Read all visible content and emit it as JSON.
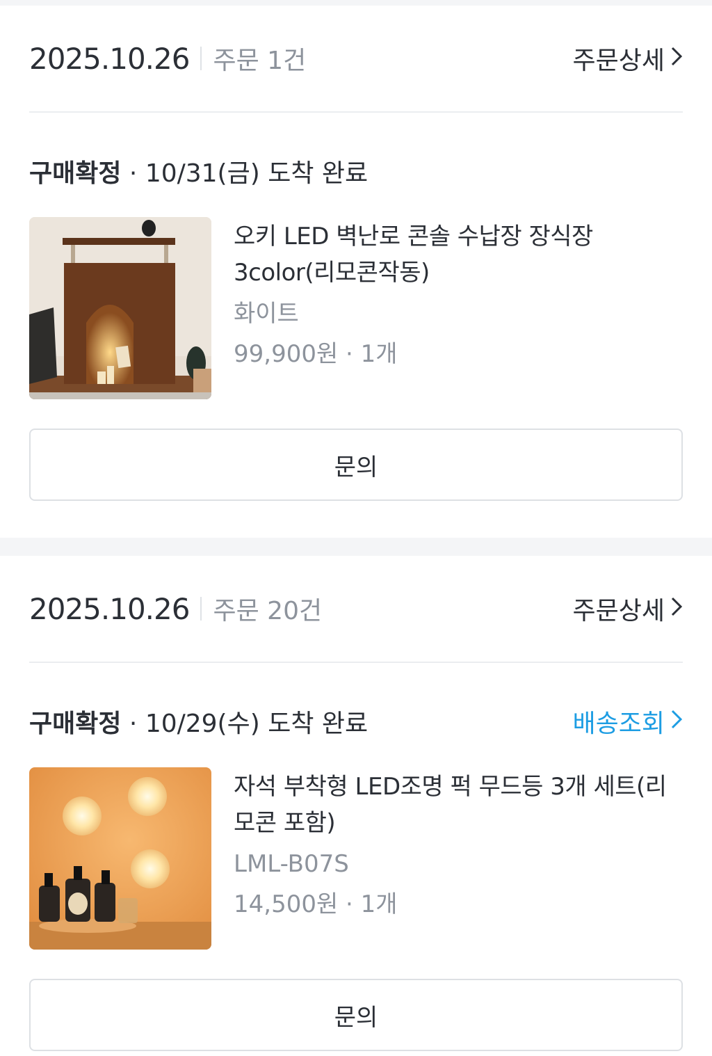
{
  "orders": [
    {
      "date": "2025.10.26",
      "count": "주문 1건",
      "detail_label": "주문상세",
      "status": "구매확정",
      "status_detail": " · 10/31(금) 도착 완료",
      "tracking_label": "",
      "product": {
        "name": "오키 LED 벽난로 콘솔 수납장 장식장 3color(리모콘작동)",
        "option": "화이트",
        "price": "99,900원 · 1개",
        "image": "wooden-fireplace-console"
      },
      "inquiry_label": "문의"
    },
    {
      "date": "2025.10.26",
      "count": "주문 20건",
      "detail_label": "주문상세",
      "status": "구매확정",
      "status_detail": " · 10/29(수) 도착 완료",
      "tracking_label": "배송조회",
      "product": {
        "name": "자석 부착형 LED조명 퍽 무드등 3개 세트(리모콘 포함)",
        "option": "LML-B07S",
        "price": "14,500원 · 1개",
        "image": "led-puck-lights"
      },
      "inquiry_label": "문의"
    }
  ],
  "colors": {
    "text_primary": "#2b2f36",
    "text_secondary": "#8d939c",
    "link_blue": "#1d9de3",
    "divider": "#ebedf0",
    "section_gap": "#f4f5f7"
  }
}
